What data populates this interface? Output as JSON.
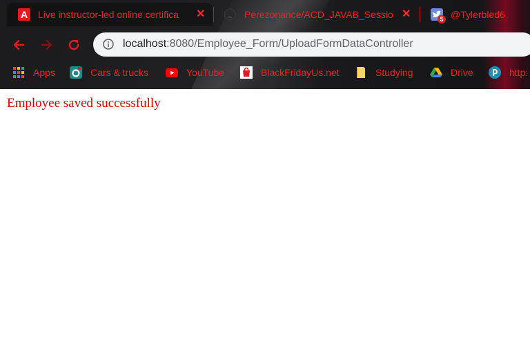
{
  "browser": {
    "tabs": [
      {
        "title": "Live instructor-led online certifica",
        "favicon": "adobe-a-icon",
        "active": true
      },
      {
        "title": "Perezonance/ACD_JAVAB_Session",
        "favicon": "github-icon",
        "active": false
      },
      {
        "title": "@Tylerbled6",
        "favicon": "twitter-badge-icon",
        "active": false,
        "badge": "5"
      }
    ],
    "colors": {
      "tab_text": "#ff1a1a",
      "bookmark_text": "#ff1a1a",
      "nav_icon": "#e01c1c",
      "accent_red": "#e31b23"
    },
    "toolbar": {
      "back_icon": "back-arrow-icon",
      "forward_icon": "forward-arrow-icon",
      "reload_icon": "reload-icon",
      "url_host": "localhost",
      "url_path": ":8080/Employee_Form/UploadFormDataController"
    },
    "bookmarks": [
      {
        "label": "Apps",
        "icon": "apps-grid-icon"
      },
      {
        "label": "Cars & trucks",
        "icon": "cars-trucks-icon"
      },
      {
        "label": "YouTube",
        "icon": "youtube-icon"
      },
      {
        "label": "BlackFridayUs.net",
        "icon": "blackfriday-icon"
      },
      {
        "label": "Studying",
        "icon": "folder-icon"
      },
      {
        "label": "Drive",
        "icon": "google-drive-icon"
      },
      {
        "label": "http:",
        "icon": "pearson-icon"
      }
    ]
  },
  "page": {
    "message": "Employee saved successfully",
    "message_color": "#e00000"
  }
}
